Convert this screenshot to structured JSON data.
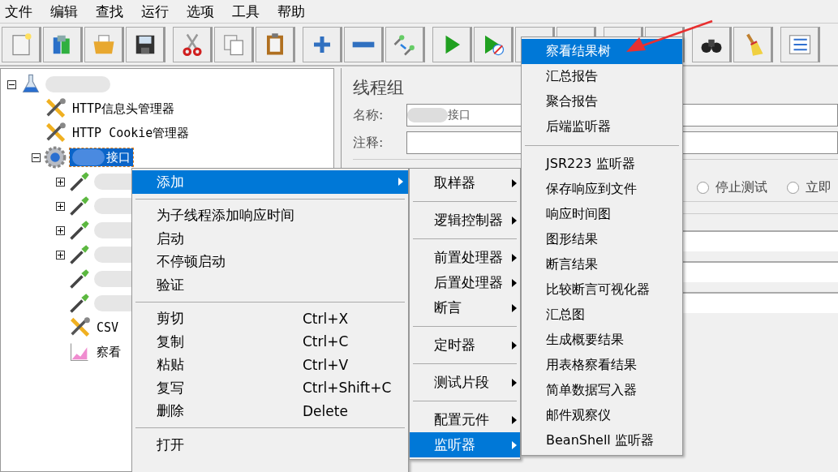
{
  "menu_bar": [
    {
      "label": "文件"
    },
    {
      "label": "编辑"
    },
    {
      "label": "查找"
    },
    {
      "label": "运行"
    },
    {
      "label": "选项"
    },
    {
      "label": "工具"
    },
    {
      "label": "帮助"
    }
  ],
  "tree": {
    "kind": "plan",
    "expanded": true,
    "selected": false,
    "children": [
      {
        "kind": "config",
        "label": "HTTP信息头管理器",
        "selected": false
      },
      {
        "kind": "config",
        "label": "HTTP Cookie管理器",
        "selected": false
      },
      {
        "kind": "threadgroup",
        "label": "接口",
        "redacted": true,
        "expanded": true,
        "selected": true,
        "children": [
          {
            "kind": "sampler",
            "expanded": false,
            "selected": false
          },
          {
            "kind": "sampler",
            "expanded": false,
            "selected": false
          },
          {
            "kind": "sampler",
            "expanded": false,
            "selected": false
          },
          {
            "kind": "sampler",
            "expanded": false,
            "selected": false
          },
          {
            "kind": "sampler",
            "selected": false
          },
          {
            "kind": "sampler",
            "selected": false
          },
          {
            "kind": "config",
            "label": "CSV",
            "selected": false
          },
          {
            "kind": "listener",
            "label": "察看",
            "selected": false
          }
        ]
      }
    ]
  },
  "panel": {
    "title": "线程组",
    "name_label": "名称:",
    "name_value": "接口",
    "comment_label": "注释:",
    "radios": [
      {
        "label": "停止测试",
        "selected": false
      },
      {
        "label": "立即",
        "selected": false
      }
    ]
  },
  "context_menu": {
    "items": [
      {
        "kind": "submenu",
        "label": "添加",
        "selected": true
      },
      {
        "kind": "separator"
      },
      {
        "kind": "item",
        "label": "为子线程添加响应时间"
      },
      {
        "kind": "item",
        "label": "启动"
      },
      {
        "kind": "item",
        "label": "不停顿启动"
      },
      {
        "kind": "item",
        "label": "验证"
      },
      {
        "kind": "separator"
      },
      {
        "kind": "item",
        "label": "剪切",
        "shortcut": "Ctrl+X"
      },
      {
        "kind": "item",
        "label": "复制",
        "shortcut": "Ctrl+C"
      },
      {
        "kind": "item",
        "label": "粘贴",
        "shortcut": "Ctrl+V"
      },
      {
        "kind": "item",
        "label": "复写",
        "shortcut": "Ctrl+Shift+C"
      },
      {
        "kind": "item",
        "label": "删除",
        "shortcut": "Delete"
      },
      {
        "kind": "separator"
      },
      {
        "kind": "item",
        "label": "打开"
      }
    ]
  },
  "add_submenu": {
    "items": [
      {
        "kind": "submenu",
        "label": "取样器",
        "selected": false
      },
      {
        "kind": "separator"
      },
      {
        "kind": "submenu",
        "label": "逻辑控制器",
        "selected": false
      },
      {
        "kind": "separator"
      },
      {
        "kind": "submenu",
        "label": "前置处理器",
        "selected": false
      },
      {
        "kind": "submenu",
        "label": "后置处理器",
        "selected": false
      },
      {
        "kind": "submenu",
        "label": "断言",
        "selected": false
      },
      {
        "kind": "separator"
      },
      {
        "kind": "submenu",
        "label": "定时器",
        "selected": false
      },
      {
        "kind": "separator"
      },
      {
        "kind": "submenu",
        "label": "测试片段",
        "selected": false
      },
      {
        "kind": "separator"
      },
      {
        "kind": "submenu",
        "label": "配置元件",
        "selected": false
      },
      {
        "kind": "submenu",
        "label": "监听器",
        "selected": true
      }
    ]
  },
  "listener_submenu": {
    "items": [
      {
        "kind": "item",
        "label": "察看结果树",
        "selected": true
      },
      {
        "kind": "item",
        "label": "汇总报告",
        "selected": false
      },
      {
        "kind": "item",
        "label": "聚合报告",
        "selected": false
      },
      {
        "kind": "item",
        "label": "后端监听器",
        "selected": false
      },
      {
        "kind": "separator"
      },
      {
        "kind": "item",
        "label": "JSR223 监听器",
        "selected": false
      },
      {
        "kind": "item",
        "label": "保存响应到文件",
        "selected": false
      },
      {
        "kind": "item",
        "label": "响应时间图",
        "selected": false
      },
      {
        "kind": "item",
        "label": "图形结果",
        "selected": false
      },
      {
        "kind": "item",
        "label": "断言结果",
        "selected": false
      },
      {
        "kind": "item",
        "label": "比较断言可视化器",
        "selected": false
      },
      {
        "kind": "item",
        "label": "汇总图",
        "selected": false
      },
      {
        "kind": "item",
        "label": "生成概要结果",
        "selected": false
      },
      {
        "kind": "item",
        "label": "用表格察看结果",
        "selected": false
      },
      {
        "kind": "item",
        "label": "简单数据写入器",
        "selected": false
      },
      {
        "kind": "item",
        "label": "邮件观察仪",
        "selected": false
      },
      {
        "kind": "item",
        "label": "BeanShell 监听器",
        "selected": false
      }
    ]
  }
}
